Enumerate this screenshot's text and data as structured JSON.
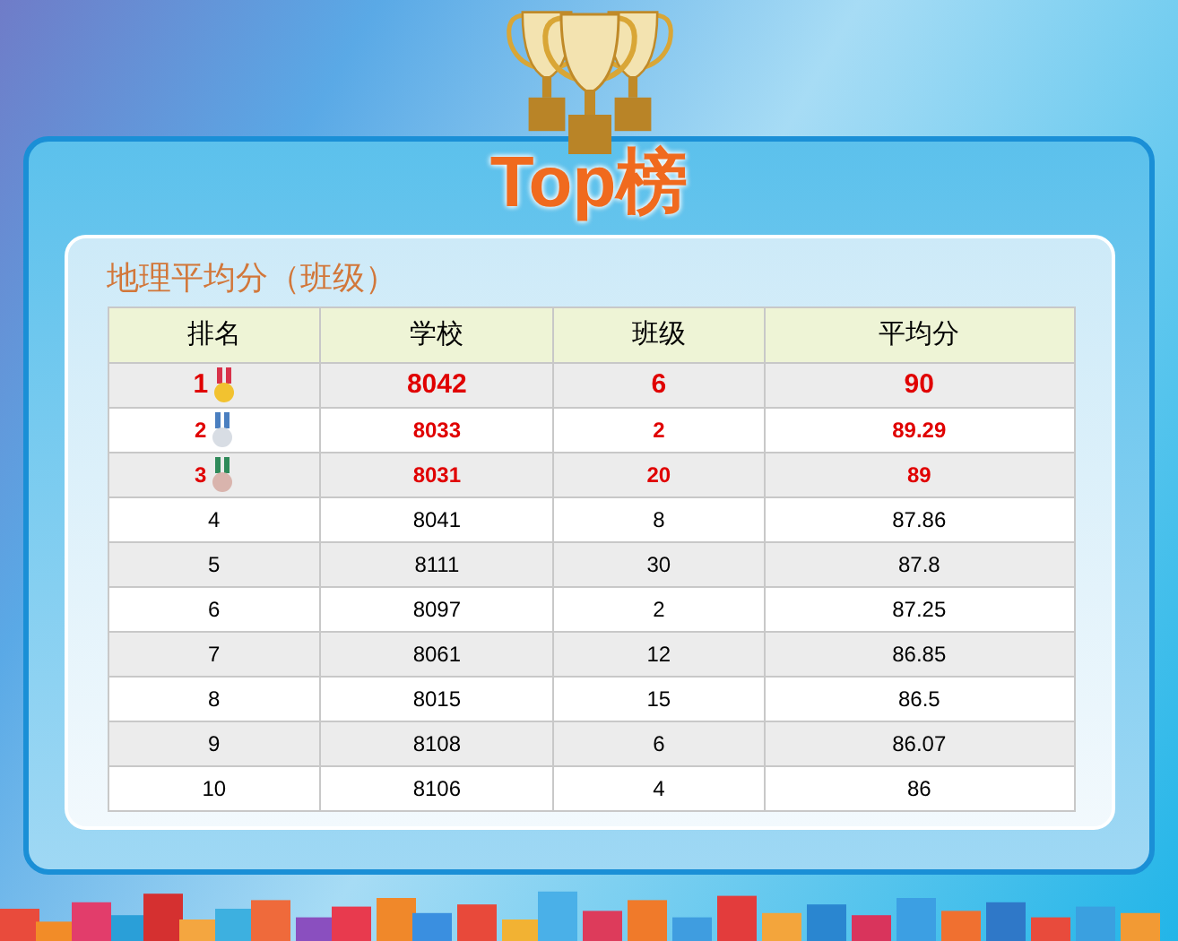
{
  "banner": {
    "title": "Top榜"
  },
  "board": {
    "title": "地理平均分（班级）",
    "columns": [
      "排名",
      "学校",
      "班级",
      "平均分"
    ],
    "rows": [
      {
        "kind": "champion",
        "color": "#f2c230",
        "cells": [
          "1",
          "8042",
          "6",
          "90"
        ]
      },
      {
        "kind": "medalist",
        "color": "#d8dde4",
        "cells": [
          "2",
          "8033",
          "2",
          "89.29"
        ]
      },
      {
        "kind": "medalist",
        "color": "#d9b4ad",
        "cells": [
          "3",
          "8031",
          "20",
          "89"
        ]
      },
      {
        "kind": "plain",
        "cells": [
          "4",
          "8041",
          "8",
          "87.86"
        ]
      },
      {
        "kind": "plain",
        "cells": [
          "5",
          "8111",
          "30",
          "87.8"
        ]
      },
      {
        "kind": "plain",
        "cells": [
          "6",
          "8097",
          "2",
          "87.25"
        ]
      },
      {
        "kind": "plain",
        "cells": [
          "7",
          "8061",
          "12",
          "86.85"
        ]
      },
      {
        "kind": "plain",
        "cells": [
          "8",
          "8015",
          "15",
          "86.5"
        ]
      },
      {
        "kind": "plain",
        "cells": [
          "9",
          "8108",
          "6",
          "86.07"
        ]
      },
      {
        "kind": "plain",
        "cells": [
          "10",
          "8106",
          "4",
          "86"
        ]
      }
    ]
  }
}
